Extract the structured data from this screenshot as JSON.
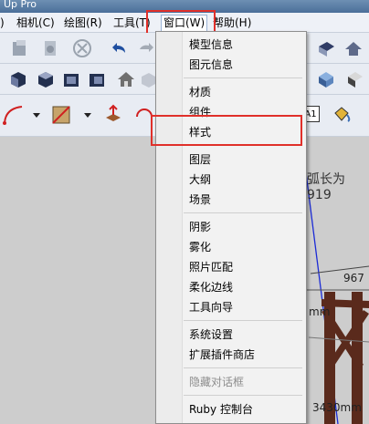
{
  "window": {
    "title": "Up Pro"
  },
  "menubar": {
    "items": [
      {
        "id": "camera",
        "label": "相机(C)"
      },
      {
        "id": "draw",
        "label": "绘图(R)"
      },
      {
        "id": "tools",
        "label": "工具(T)"
      },
      {
        "id": "window",
        "label": "窗口(W)"
      },
      {
        "id": "help",
        "label": "帮助(H)"
      }
    ]
  },
  "window_menu": {
    "items": [
      {
        "label": "模型信息"
      },
      {
        "label": "图元信息"
      },
      {
        "label": "材质"
      },
      {
        "label": "组件"
      },
      {
        "label": "样式"
      },
      {
        "label": "图层"
      },
      {
        "label": "大纲"
      },
      {
        "label": "场景"
      },
      {
        "label": "阴影"
      },
      {
        "label": "雾化"
      },
      {
        "label": "照片匹配"
      },
      {
        "label": "柔化边线"
      },
      {
        "label": "工具向导"
      },
      {
        "label": "系统设置"
      },
      {
        "label": "扩展插件商店"
      },
      {
        "label": "隐藏对话框",
        "disabled": true
      },
      {
        "label": "Ruby 控制台"
      }
    ]
  },
  "canvas": {
    "text_length": "弧长为919",
    "dim_967": "967",
    "dim_mm": "mm",
    "dim_3430": "3430mm"
  },
  "toolbar": {
    "a1_label": "A1"
  },
  "colors": {
    "highlight_red": "#e0302a",
    "menu_bg": "#f2f2f2",
    "wood_dark": "#5a2a1c",
    "axis_blue": "#1b2bd6"
  }
}
